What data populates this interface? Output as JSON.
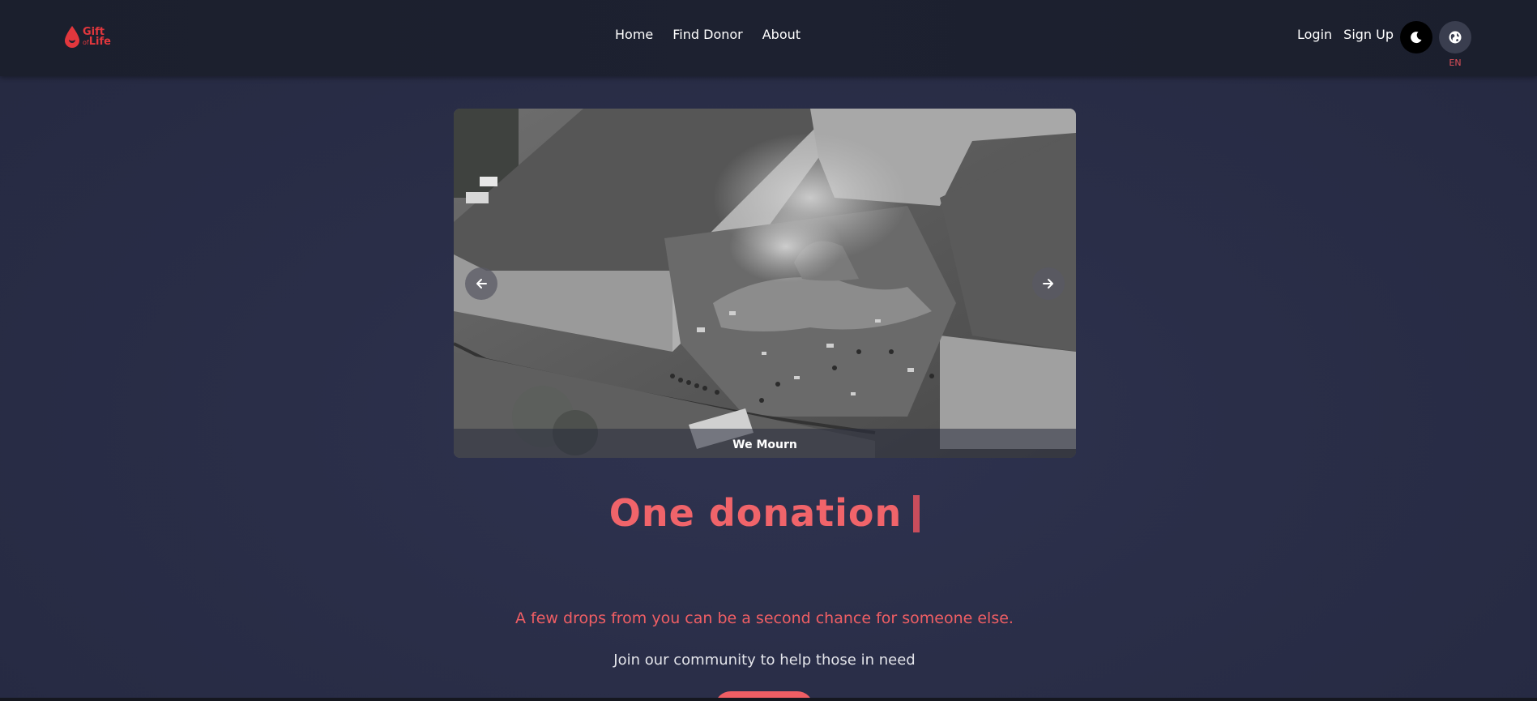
{
  "brand": {
    "logo_line1": "Gift",
    "logo_line2_small": "of",
    "logo_line2": "Life",
    "accent_color": "#e2373d"
  },
  "nav": {
    "items": [
      {
        "label": "Home"
      },
      {
        "label": "Find Donor"
      },
      {
        "label": "About"
      }
    ]
  },
  "auth": {
    "login_label": "Login",
    "signup_label": "Sign Up"
  },
  "controls": {
    "theme_icon": "moon-icon",
    "language_icon": "globe-icon",
    "language_code": "EN"
  },
  "carousel": {
    "caption": "We Mourn",
    "prev_icon": "arrow-left-icon",
    "next_icon": "arrow-right-icon"
  },
  "hero": {
    "headline": "One donation",
    "tagline": "A few drops from you can be a second chance for someone else.",
    "subline": "Join our community to help those in need",
    "headline_color": "#f0646a"
  }
}
